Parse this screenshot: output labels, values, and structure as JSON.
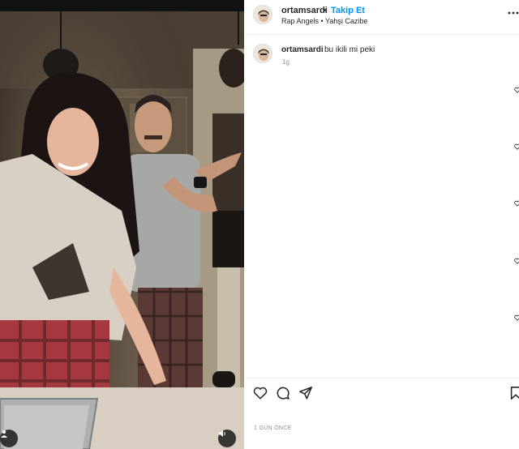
{
  "post": {
    "username": "ortamsardi",
    "separator": "•",
    "follow_label": "Takip Et",
    "audio_info": "Rap Angels • Yahşi Cazibe",
    "caption_username": "ortamsardi",
    "caption_text": "bu ikili mi peki",
    "caption_age": "1g",
    "posted_ago": "1 GÜN ÖNCE"
  },
  "icons": {
    "more": "more-horizontal-icon",
    "like": "heart-icon",
    "comment": "comment-icon",
    "share": "paper-plane-icon",
    "save": "bookmark-icon",
    "tagged_users": "user-icon",
    "audio": "speaker-icon"
  },
  "colors": {
    "follow_blue": "#0095f6",
    "text": "#262626",
    "secondary": "#8e8e8e",
    "divider": "#efefef"
  }
}
